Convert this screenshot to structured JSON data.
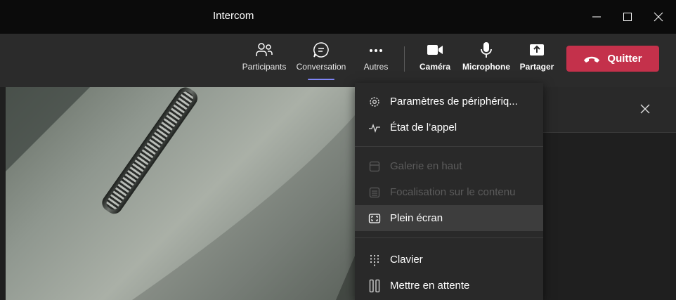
{
  "window": {
    "title": "Intercom"
  },
  "toolbar": {
    "participants": "Participants",
    "conversation": "Conversation",
    "more": "Autres",
    "camera": "Caméra",
    "microphone": "Microphone",
    "share": "Partager",
    "quit": "Quitter"
  },
  "menu": {
    "items": [
      {
        "label": "Paramètres de périphériq...",
        "icon": "gear-icon",
        "enabled": true
      },
      {
        "label": "État de l’appel",
        "icon": "pulse-icon",
        "enabled": true
      },
      {
        "label": "Galerie en haut",
        "icon": "gallery-icon",
        "enabled": false
      },
      {
        "label": "Focalisation sur le contenu",
        "icon": "content-focus-icon",
        "enabled": false
      },
      {
        "label": "Plein écran",
        "icon": "fullscreen-icon",
        "enabled": true,
        "highlighted": true
      },
      {
        "label": "Clavier",
        "icon": "dialpad-icon",
        "enabled": true
      },
      {
        "label": "Mettre en attente",
        "icon": "pause-icon",
        "enabled": true
      }
    ]
  },
  "colors": {
    "accent": "#7f85f5",
    "quit": "#c4314b",
    "menu_bg": "#292929",
    "toolbar_bg": "#2b2b2b",
    "titlebar_bg": "#0b0b0b"
  }
}
